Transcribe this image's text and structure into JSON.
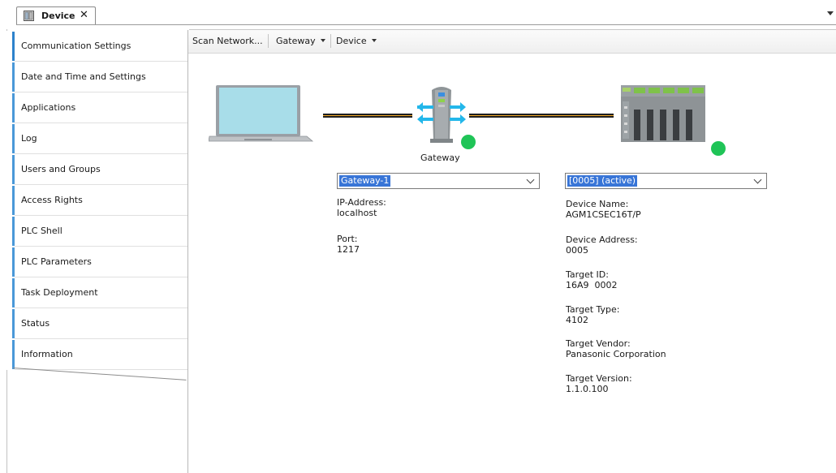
{
  "tab": {
    "title": "Device"
  },
  "nav": {
    "items": [
      {
        "label": "Communication Settings",
        "active": true
      },
      {
        "label": "Date and Time and Settings"
      },
      {
        "label": "Applications"
      },
      {
        "label": "Log"
      },
      {
        "label": "Users and Groups"
      },
      {
        "label": "Access Rights"
      },
      {
        "label": "PLC Shell"
      },
      {
        "label": "PLC Parameters"
      },
      {
        "label": "Task Deployment"
      },
      {
        "label": "Status"
      },
      {
        "label": "Information"
      }
    ]
  },
  "toolbar": {
    "scan_network": "Scan Network...",
    "gateway": "Gateway",
    "device": "Device"
  },
  "gateway": {
    "caption": "Gateway",
    "selected": "Gateway-1",
    "ip_label": "IP-Address:",
    "ip_value": "localhost",
    "port_label": "Port:",
    "port_value": "1217"
  },
  "device": {
    "selected": "[0005] (active)",
    "name_label": "Device Name:",
    "name_value": "AGM1CSEC16T/P",
    "address_label": "Device Address:",
    "address_value": "0005",
    "target_id_label": "Target ID:",
    "target_id_value": "16A9  0002",
    "target_type_label": "Target Type:",
    "target_type_value": "4102",
    "target_vendor_label": "Target Vendor:",
    "target_vendor_value": "Panasonic Corporation",
    "target_version_label": "Target Version:",
    "target_version_value": "1.1.0.100"
  },
  "colors": {
    "status_ok": "#1fc457",
    "selection": "#3875d7",
    "nav_accent": "#4a98d8",
    "link_line": "#f0a828"
  }
}
